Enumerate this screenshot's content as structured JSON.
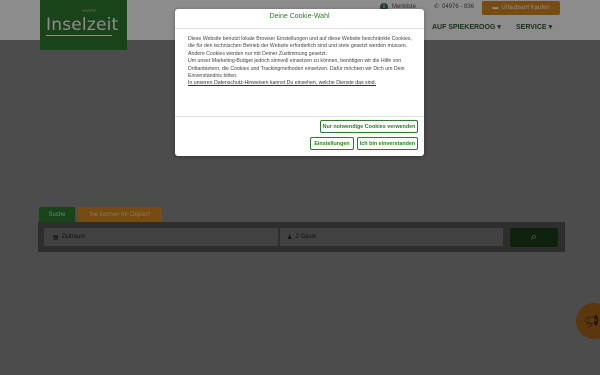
{
  "header": {
    "logo_text": "Inselzeit",
    "merkzettel_count": "0",
    "merkzettel_label": "Merkliste",
    "phone": "04976 - 836",
    "cta_label": "Urlaubsort Kaufen",
    "nav": [
      {
        "label": "AUF SPIEKEROOG",
        "chevron": "▾"
      },
      {
        "label": "SERVICE",
        "chevron": "▾"
      }
    ]
  },
  "search": {
    "tab_suche": "Suche",
    "tab_kennen": "Sie kennen Ihr Objekt?",
    "zeitraum": "Zeitraum",
    "gaeste": "2 Gäste"
  },
  "cookie_modal": {
    "title": "Deine Cookie-Wahl",
    "paragraphs": [
      "Diese Website benutzt lokale Browser Einstellungen und auf diese Website beschränkte Cookies, die für den technischen Betrieb der Website erforderlich sind und stets gesetzt werden müssen.",
      "Andere Cookies werden nur mit Deiner Zustimmung gesetzt.",
      "Um unser Marketing-Budget jedoch sinnvoll einsetzen zu können, benötigen wir die Hilfe von Drittanbietern, die Cookies und Trackingmethoden einsetzen. Dafür möchten wir Dich um Dein Einverständnis bitten."
    ],
    "privacy_link": "In unseren Datenschutz-Hinweisen kannst Du einsehen, welche Dienste das sind.",
    "btn_necessary": "Nur notwendige Cookies verwenden",
    "btn_settings": "Einstellungen",
    "btn_accept": "Ich bin einverstanden"
  },
  "colors": {
    "brand_green": "#2f7a2c",
    "accent_orange": "#d98a1f"
  }
}
